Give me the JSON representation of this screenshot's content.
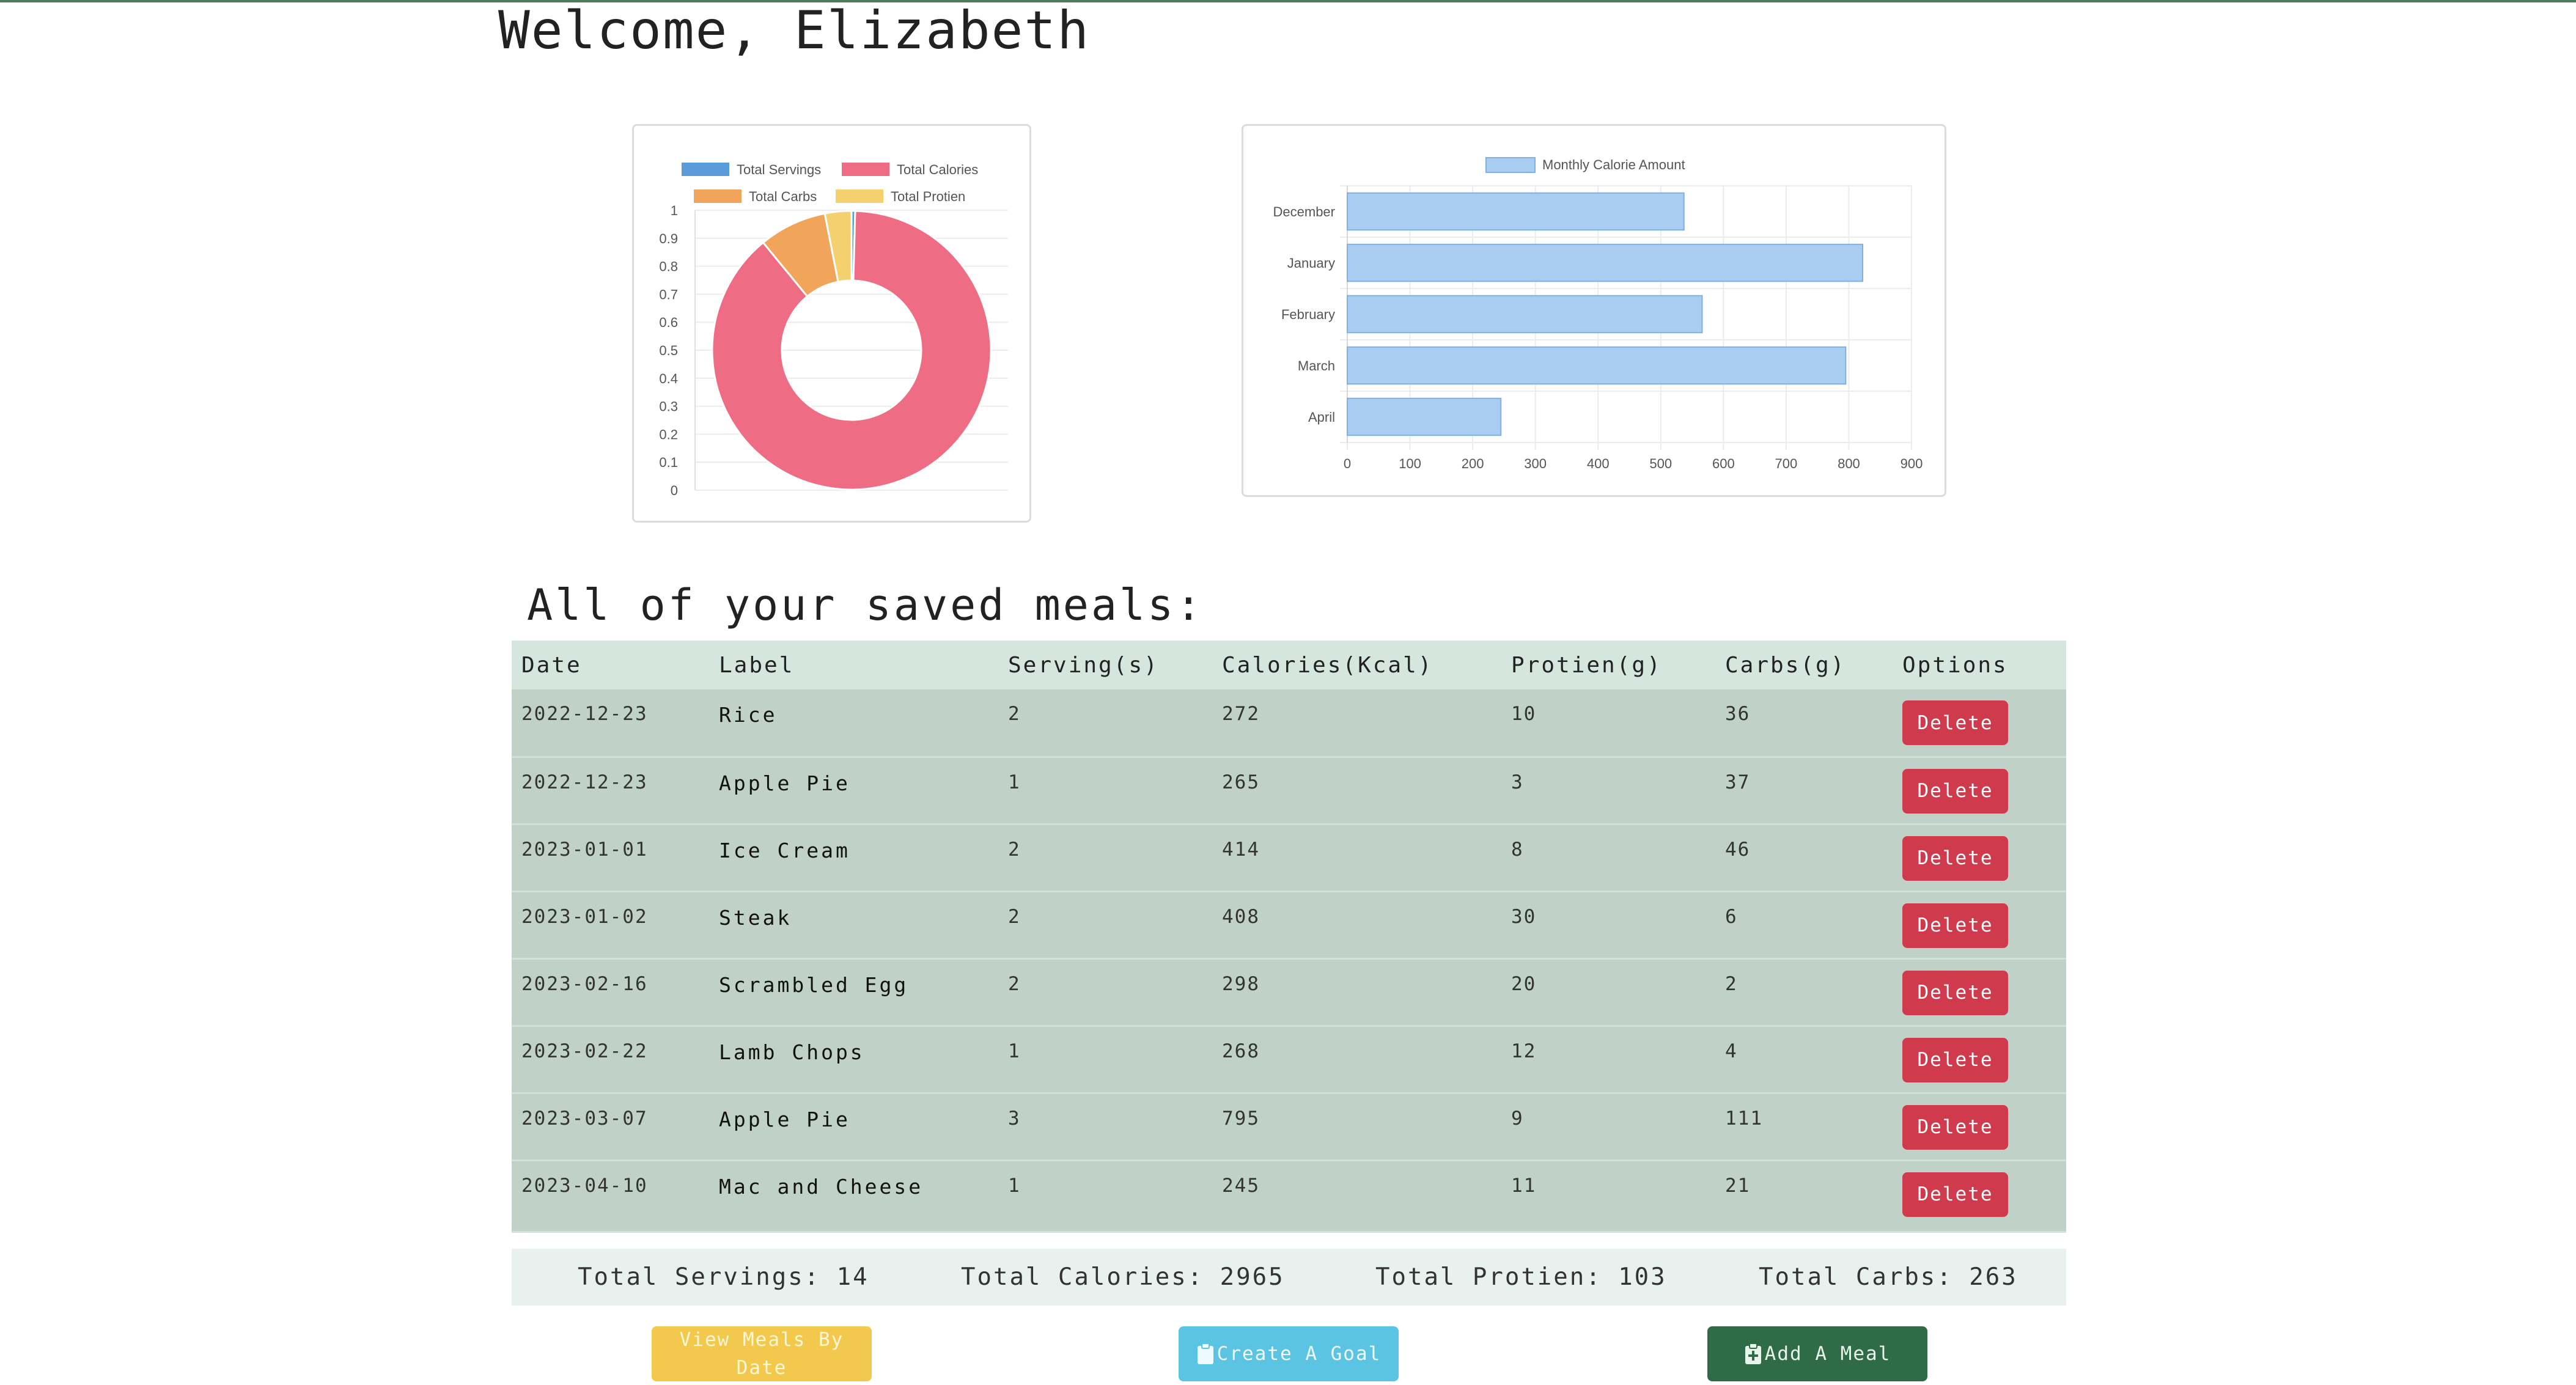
{
  "header": {
    "welcome": "Welcome, Elizabeth"
  },
  "chart_data": [
    {
      "type": "pie",
      "variant": "doughnut",
      "legend": [
        "Total Servings",
        "Total Calories",
        "Total Carbs",
        "Total Protien"
      ],
      "legend_position": "top",
      "values": [
        14,
        2965,
        263,
        103
      ],
      "colors": [
        "#5b9bd9",
        "#ef6d84",
        "#f0a55a",
        "#f5d06e"
      ],
      "y_ticks": [
        "1",
        "0.9",
        "0.8",
        "0.7",
        "0.6",
        "0.5",
        "0.4",
        "0.3",
        "0.2",
        "0.1",
        "0"
      ],
      "ylim": [
        0,
        1
      ],
      "grid": true
    },
    {
      "type": "bar",
      "orientation": "horizontal",
      "legend": [
        "Monthly Calorie Amount"
      ],
      "legend_position": "top",
      "categories": [
        "December",
        "January",
        "February",
        "March",
        "April"
      ],
      "values": [
        537,
        822,
        566,
        795,
        245
      ],
      "x_ticks": [
        "0",
        "100",
        "200",
        "300",
        "400",
        "500",
        "600",
        "700",
        "800",
        "900"
      ],
      "xlim": [
        0,
        900
      ],
      "bar_color": "#a8cdf1",
      "bar_border": "#7fb1e3",
      "grid": true
    }
  ],
  "meals": {
    "title": "All of your saved meals:",
    "columns": [
      "Date",
      "Label",
      "Serving(s)",
      "Calories(Kcal)",
      "Protien(g)",
      "Carbs(g)",
      "Options"
    ],
    "rows": [
      {
        "date": "2022-12-23",
        "label": "Rice",
        "servings": "2",
        "calories": "272",
        "protien": "10",
        "carbs": "36",
        "option": "Delete"
      },
      {
        "date": "2022-12-23",
        "label": "Apple Pie",
        "servings": "1",
        "calories": "265",
        "protien": "3",
        "carbs": "37",
        "option": "Delete"
      },
      {
        "date": "2023-01-01",
        "label": "Ice Cream",
        "servings": "2",
        "calories": "414",
        "protien": "8",
        "carbs": "46",
        "option": "Delete"
      },
      {
        "date": "2023-01-02",
        "label": "Steak",
        "servings": "2",
        "calories": "408",
        "protien": "30",
        "carbs": "6",
        "option": "Delete"
      },
      {
        "date": "2023-02-16",
        "label": "Scrambled Egg",
        "servings": "2",
        "calories": "298",
        "protien": "20",
        "carbs": "2",
        "option": "Delete"
      },
      {
        "date": "2023-02-22",
        "label": "Lamb Chops",
        "servings": "1",
        "calories": "268",
        "protien": "12",
        "carbs": "4",
        "option": "Delete"
      },
      {
        "date": "2023-03-07",
        "label": "Apple Pie",
        "servings": "3",
        "calories": "795",
        "protien": "9",
        "carbs": "111",
        "option": "Delete"
      },
      {
        "date": "2023-04-10",
        "label": "Mac and Cheese",
        "servings": "1",
        "calories": "245",
        "protien": "11",
        "carbs": "21",
        "option": "Delete"
      }
    ]
  },
  "totals": {
    "servings": "Total Servings: 14",
    "calories": "Total Calories: 2965",
    "protien": "Total Protien: 103",
    "carbs": "Total Carbs: 263"
  },
  "actions": {
    "view_by_date": "View Meals By Date",
    "create_goal": "Create A Goal",
    "add_meal": "Add A Meal",
    "goal_icon": "clipboard-icon",
    "meal_icon": "clipboard-plus-icon"
  }
}
